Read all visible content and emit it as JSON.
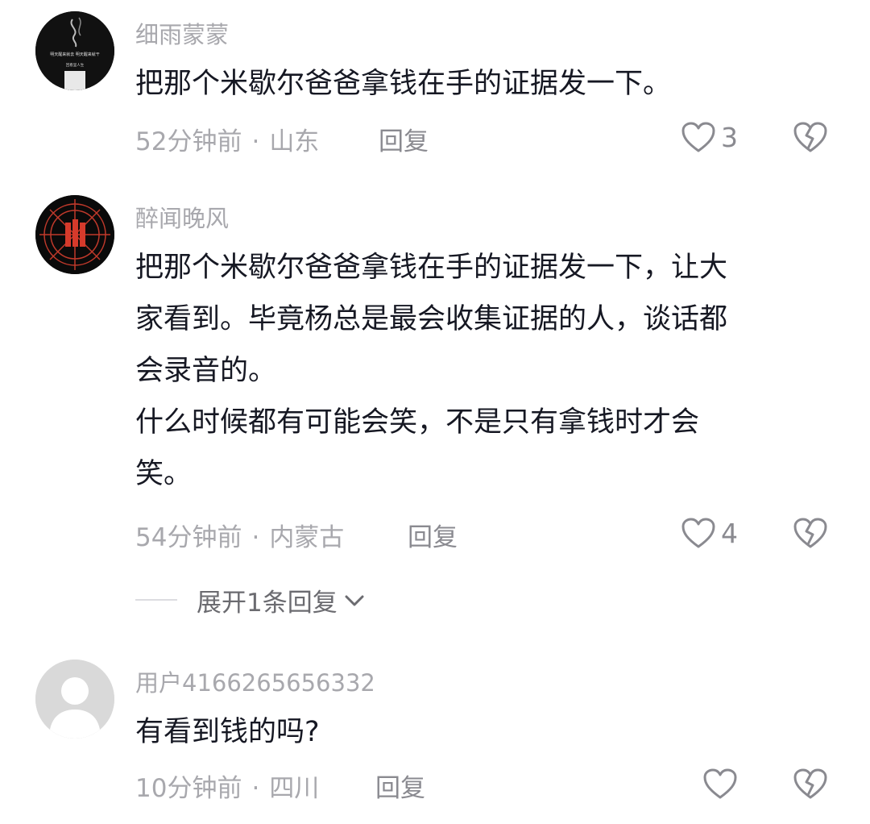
{
  "comments": [
    {
      "username": "细雨蒙蒙",
      "avatar_text": [
        "明天醒来就去 明天醒来就干",
        "回看里人生"
      ],
      "lines": [
        "把那个米歇尔爸爸拿钱在手的证据发一下。"
      ],
      "time": "52分钟前",
      "location": "山东",
      "reply_label": "回复",
      "likes": "3"
    },
    {
      "username": "醉闻晚风",
      "lines": [
        "把那个米歇尔爸爸拿钱在手的证据发一下，让大",
        "家看到。毕竟杨总是最会收集证据的人，谈话都",
        "会录音的。",
        "什么时候都有可能会笑，不是只有拿钱时才会",
        "笑。"
      ],
      "time": "54分钟前",
      "location": "内蒙古",
      "reply_label": "回复",
      "likes": "4"
    },
    {
      "username": "用户4166265656332",
      "lines": [
        "有看到钱的吗?"
      ],
      "time": "10分钟前",
      "location": "四川",
      "reply_label": "回复",
      "likes": ""
    }
  ],
  "expand_replies": {
    "label": "展开1条回复"
  },
  "separator": "·",
  "icons": {
    "like": "heart-outline-icon",
    "dislike": "broken-heart-icon",
    "expand": "chevron-down-icon"
  },
  "colors": {
    "text": "#161823",
    "muted": "#a8a8ad",
    "icon": "#8a8a90"
  }
}
